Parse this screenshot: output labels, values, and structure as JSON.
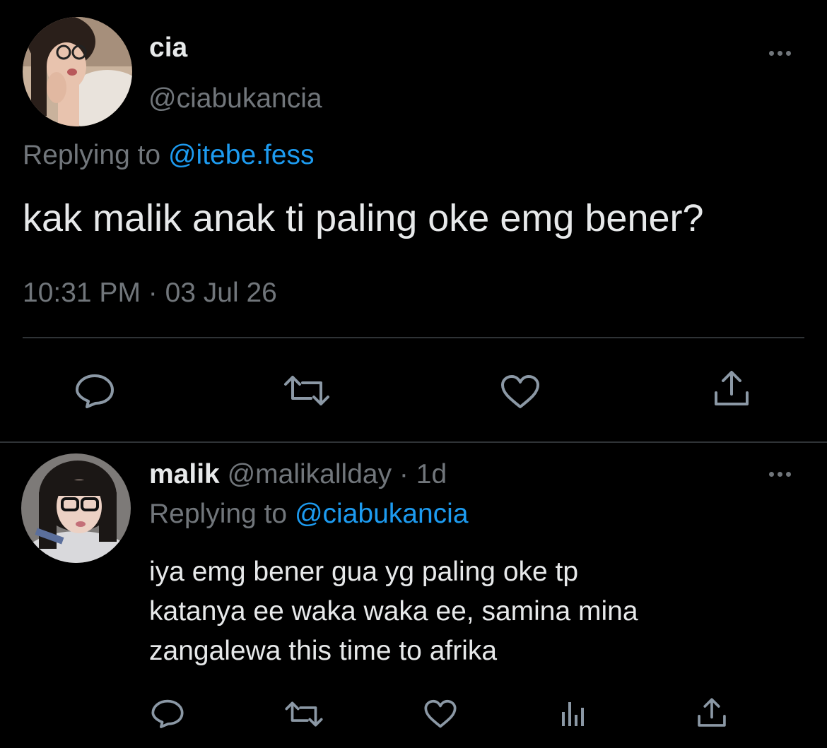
{
  "main_tweet": {
    "display_name": "cia",
    "handle": "@ciabukancia",
    "replying_to_label": "Replying to",
    "replying_to_handle": "@itebe.fess",
    "text": "kak malik anak ti paling oke emg bener?",
    "timestamp": "10:31 PM · 03 Jul 26"
  },
  "reply_tweet": {
    "display_name": "malik",
    "handle": "@malikallday",
    "separator": "·",
    "age": "1d",
    "replying_to_label": "Replying to",
    "replying_to_handle": "@ciabukancia",
    "text_lines": [
      "iya emg bener gua yg paling oke tp",
      "katanya ee waka waka ee, samina mina",
      "zangalewa this time to afrika"
    ]
  },
  "icons": {
    "reply": "reply-icon",
    "retweet": "retweet-icon",
    "like": "heart-icon",
    "share": "share-icon",
    "views": "analytics-icon",
    "more": "more-icon"
  },
  "colors": {
    "background": "#000000",
    "text": "#e7e9ea",
    "muted": "#71767b",
    "accent": "#1d9bf0",
    "divider": "#2f3336"
  }
}
